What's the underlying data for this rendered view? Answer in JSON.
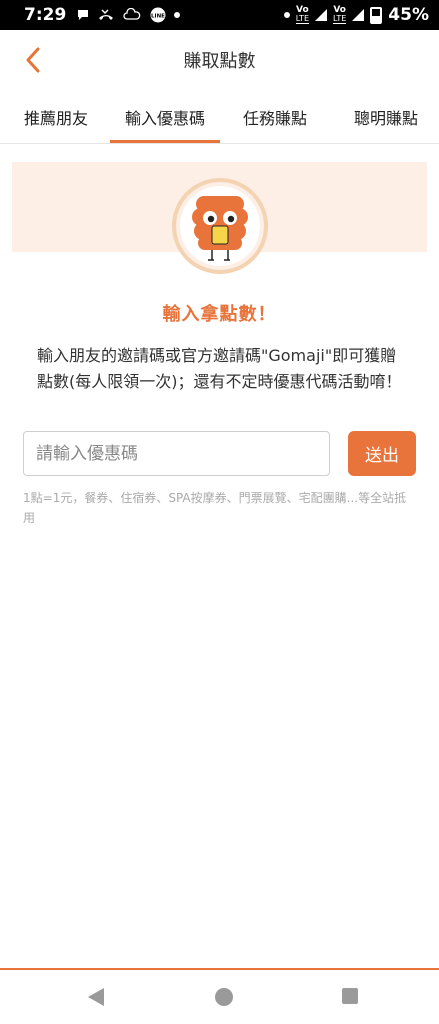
{
  "status_bar": {
    "time": "7:29",
    "battery": "45%",
    "lte1": "LTE",
    "lte2": "LTE",
    "vo1": "Vo",
    "vo2": "Vo"
  },
  "header": {
    "title": "賺取點數"
  },
  "tabs": [
    {
      "label": "推薦朋友"
    },
    {
      "label": "輸入優惠碼"
    },
    {
      "label": "任務賺點"
    },
    {
      "label": "聰明賺點"
    }
  ],
  "main": {
    "headline": "輸入拿點數！",
    "description": "輸入朋友的邀請碼或官方邀請碼\"Gomaji\"即可獲贈點數(每人限領一次)；還有不定時優惠代碼活動唷！",
    "input_placeholder": "請輸入優惠碼",
    "submit_label": "送出",
    "note": "1點=1元，餐券、住宿券、SPA按摩券、門票展覽、宅配團購...等全站抵用"
  },
  "colors": {
    "accent": "#e8743b",
    "banner_bg": "#fdeee6"
  }
}
